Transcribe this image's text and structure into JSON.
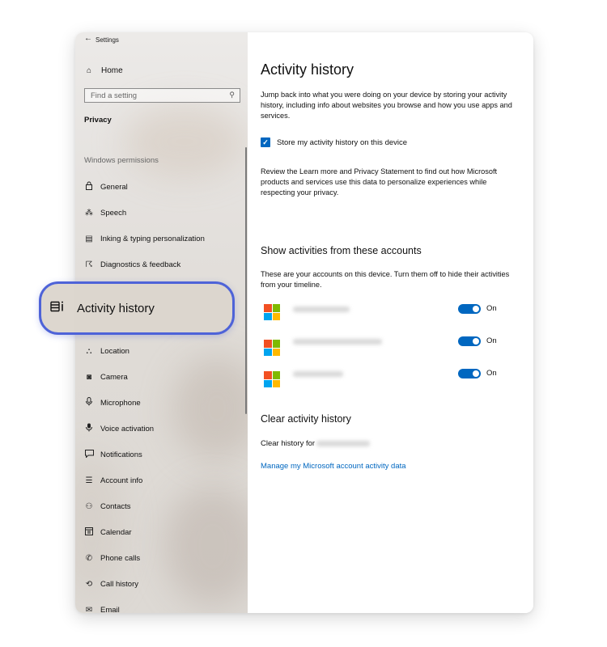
{
  "window": {
    "title": "Settings"
  },
  "sidebar": {
    "home": "Home",
    "search_placeholder": "Find a setting",
    "section": "Privacy",
    "permissions_header": "Windows permissions",
    "items": [
      {
        "label": "General",
        "icon": "lock-icon"
      },
      {
        "label": "Speech",
        "icon": "speech-icon"
      },
      {
        "label": "Inking & typing personalization",
        "icon": "inking-icon"
      },
      {
        "label": "Diagnostics & feedback",
        "icon": "diagnostics-icon"
      },
      {
        "label": "Activity history",
        "icon": "activity-history-icon",
        "highlighted": true
      },
      {
        "label": "Location",
        "icon": "location-icon"
      },
      {
        "label": "Camera",
        "icon": "camera-icon"
      },
      {
        "label": "Microphone",
        "icon": "microphone-icon"
      },
      {
        "label": "Voice activation",
        "icon": "voice-activation-icon"
      },
      {
        "label": "Notifications",
        "icon": "notifications-icon"
      },
      {
        "label": "Account info",
        "icon": "account-info-icon"
      },
      {
        "label": "Contacts",
        "icon": "contacts-icon"
      },
      {
        "label": "Calendar",
        "icon": "calendar-icon"
      },
      {
        "label": "Phone calls",
        "icon": "phone-icon"
      },
      {
        "label": "Call history",
        "icon": "call-history-icon"
      },
      {
        "label": "Email",
        "icon": "email-icon"
      }
    ]
  },
  "main": {
    "title": "Activity history",
    "intro": "Jump back into what you were doing on your device by storing your activity history, including info about websites you browse and how you use apps and services.",
    "checkbox_label": "Store my activity history on this device",
    "checkbox_checked": true,
    "review_text": "Review the Learn more and Privacy Statement to find out how Microsoft products and services use this data to personalize experiences while respecting your privacy.",
    "accounts_heading": "Show activities from these accounts",
    "accounts_desc": "These are your accounts on this device. Turn them off to hide their activities from your timeline.",
    "accounts": [
      {
        "toggle_label": "On",
        "enabled": true
      },
      {
        "toggle_label": "On",
        "enabled": true
      },
      {
        "toggle_label": "On",
        "enabled": true
      }
    ],
    "clear_heading": "Clear activity history",
    "clear_for_label": "Clear history for",
    "manage_link": "Manage my Microsoft account activity data"
  },
  "colors": {
    "accent": "#0067c0",
    "highlight_border": "#4e63d8",
    "ms_logo": [
      "#f25022",
      "#7fba00",
      "#00a4ef",
      "#ffb900"
    ]
  }
}
